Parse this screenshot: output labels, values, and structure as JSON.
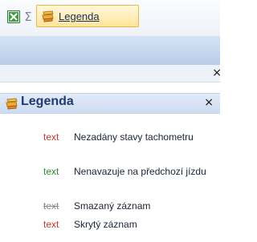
{
  "toolbar": {
    "excel_icon": "excel-icon",
    "sigma_symbol": "Σ",
    "tab_label": "Legenda",
    "tab_icon": "legend-icon"
  },
  "strip": {
    "close_symbol": "×"
  },
  "panel": {
    "title": "Legenda",
    "close_symbol": "×",
    "icon": "legend-icon"
  },
  "legend": [
    {
      "sample": "text",
      "description": "Nezadány stavy tachometru",
      "color": "#c0392b",
      "style": "normal"
    },
    {
      "sample": "text",
      "description": "Nenavazuje na předchozí jízdu",
      "color": "#2e8b3d",
      "style": "normal"
    },
    {
      "sample": "text",
      "description": "Smazaný záznam",
      "color": "#8a8a8a",
      "style": "strikethrough"
    },
    {
      "sample": "text",
      "description": "Skrytý záznam",
      "color": "#c0392b",
      "style": "normal"
    }
  ]
}
